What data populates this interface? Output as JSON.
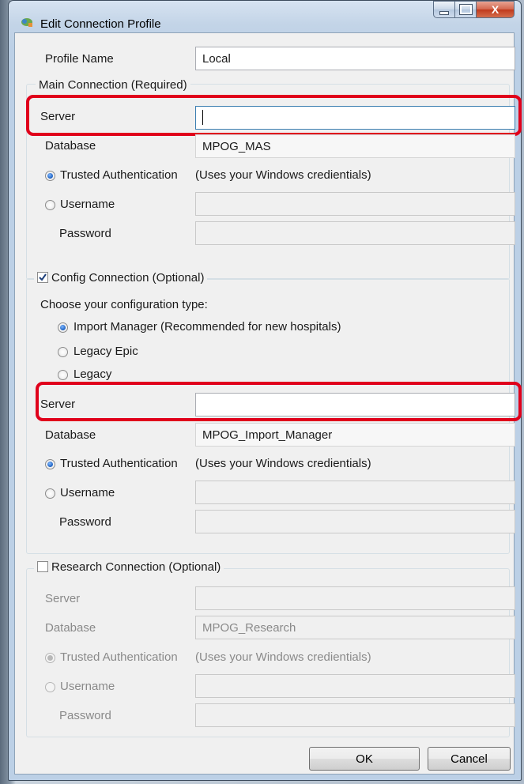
{
  "window": {
    "title": "Edit Connection Profile",
    "close_glyph": "X"
  },
  "profile": {
    "label": "Profile Name",
    "value": "Local"
  },
  "main": {
    "legend": "Main Connection (Required)",
    "server_label": "Server",
    "server_value": "",
    "database_label": "Database",
    "database_value": "MPOG_MAS",
    "trusted_label": "Trusted Authentication",
    "trusted_note": "(Uses your Windows credientials)",
    "username_label": "Username",
    "password_label": "Password"
  },
  "config": {
    "legend": "Config Connection (Optional)",
    "enabled": true,
    "choose_label": "Choose your configuration type:",
    "types": [
      "Import Manager (Recommended for new hospitals)",
      "Legacy Epic",
      "Legacy"
    ],
    "selected_type": "Import Manager (Recommended for new hospitals)",
    "server_label": "Server",
    "server_value": "",
    "database_label": "Database",
    "database_value": "MPOG_Import_Manager",
    "trusted_label": "Trusted Authentication",
    "trusted_note": "(Uses your Windows credientials)",
    "username_label": "Username",
    "password_label": "Password"
  },
  "research": {
    "legend": "Research Connection (Optional)",
    "enabled": false,
    "server_label": "Server",
    "server_value": "",
    "database_label": "Database",
    "database_value": "MPOG_Research",
    "trusted_label": "Trusted Authentication",
    "trusted_note": "(Uses your Windows credientials)",
    "username_label": "Username",
    "password_label": "Password"
  },
  "buttons": {
    "ok": "OK",
    "cancel": "Cancel"
  },
  "colors": {
    "highlight": "#e0001b",
    "radio_selected": "#1c5fbf"
  }
}
